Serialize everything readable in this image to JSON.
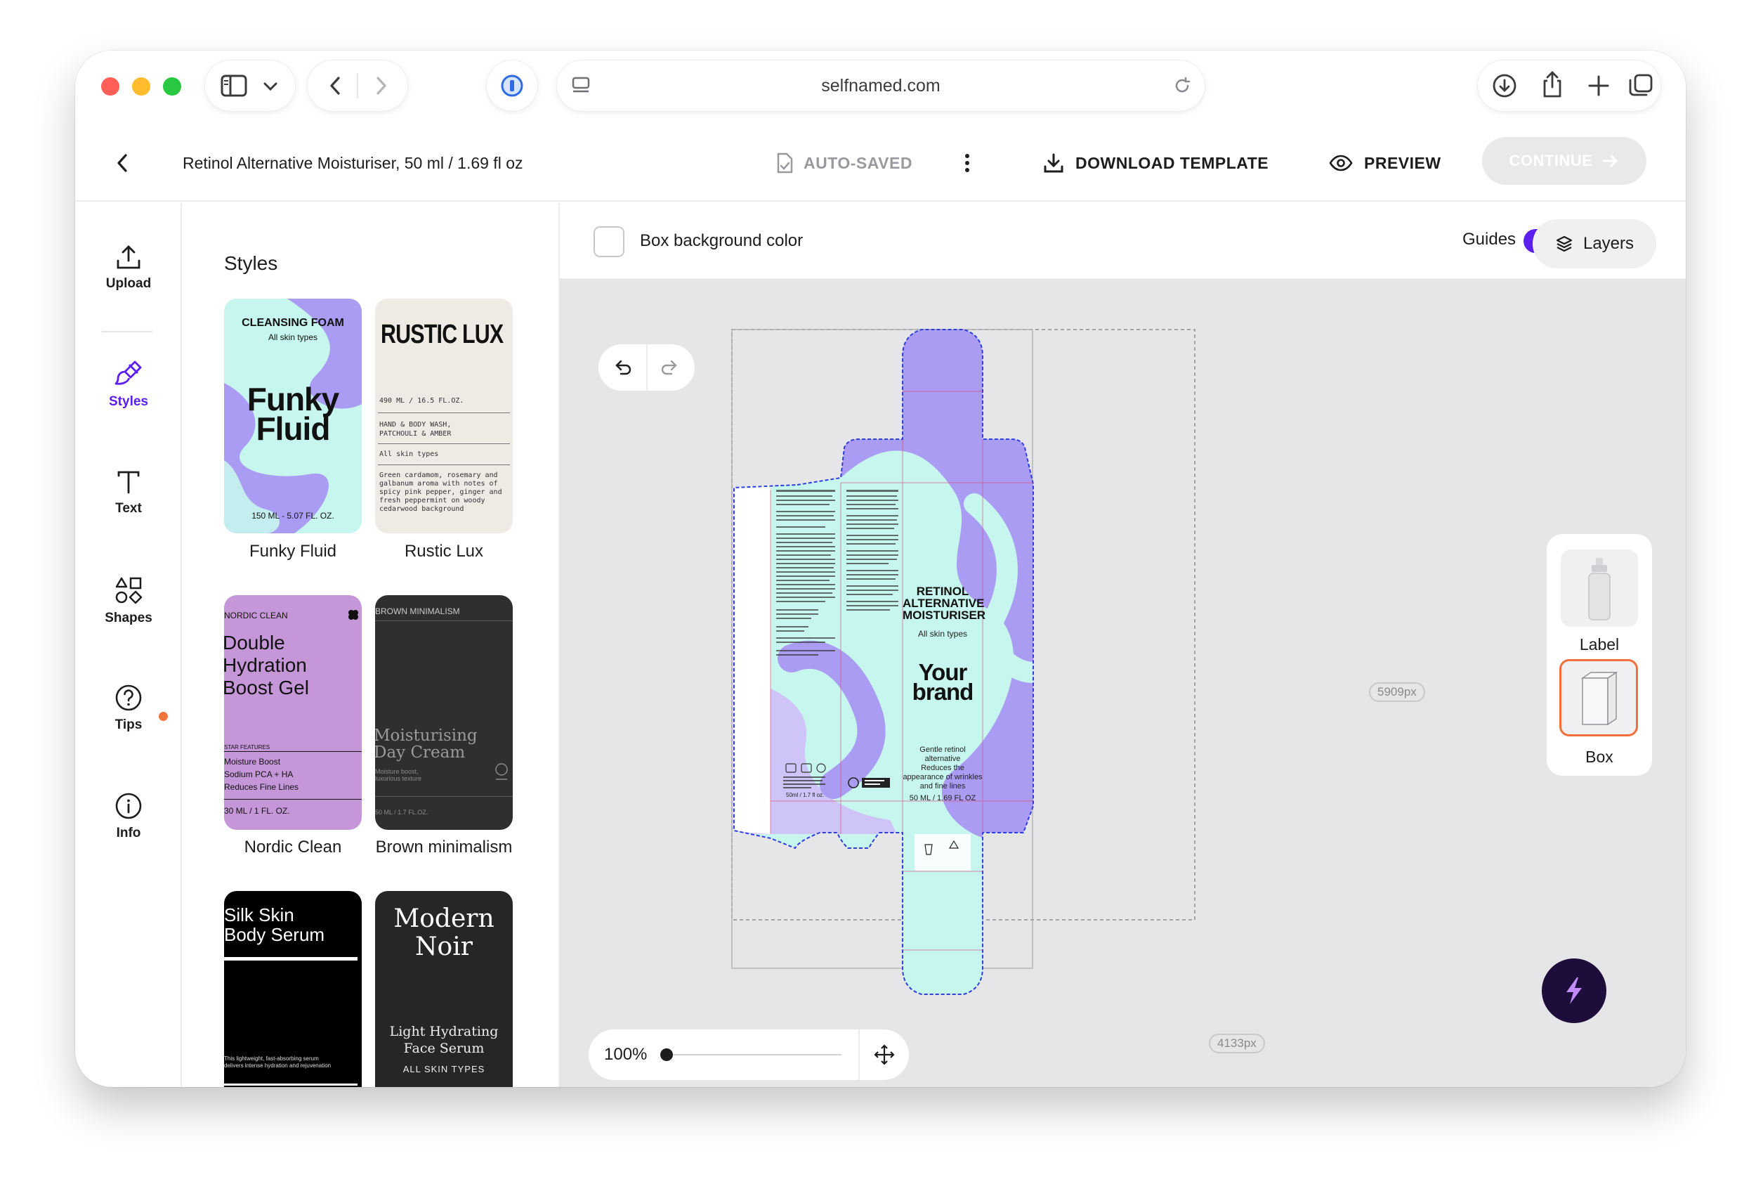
{
  "browser": {
    "url": "selfnamed.com"
  },
  "header": {
    "back_label": "",
    "product_title": "Retinol Alternative Moisturiser, 50 ml / 1.69 fl oz",
    "autosave_label": "AUTO-SAVED",
    "download_label": "DOWNLOAD TEMPLATE",
    "preview_label": "PREVIEW",
    "continue_label": "CONTINUE"
  },
  "rail": {
    "items": [
      {
        "label": "Upload",
        "icon": "upload-icon"
      },
      {
        "label": "Styles",
        "icon": "brush-icon",
        "active": true
      },
      {
        "label": "Text",
        "icon": "text-icon"
      },
      {
        "label": "Shapes",
        "icon": "shapes-icon"
      },
      {
        "label": "Tips",
        "icon": "question-icon"
      },
      {
        "label": "Info",
        "icon": "info-icon"
      }
    ]
  },
  "styles_panel": {
    "title": "Styles",
    "cards": [
      {
        "name": "Funky Fluid",
        "top": "CLEANSING FOAM",
        "sub": "All skin types",
        "big": "Funky\nFluid",
        "foot": "150 ML - 5.07 FL. OZ."
      },
      {
        "name": "Rustic Lux",
        "top": "RUSTIC LUX",
        "size": "490 ML / 16.5 FL.OZ.",
        "desc1": "HAND & BODY WASH,",
        "desc2": "PATCHOULI & AMBER",
        "type": "All skin types",
        "notes": "Green cardamom, rosemary and galbanum aroma with notes of spicy pink pepper, ginger and fresh peppermint on woody cedarwood background"
      },
      {
        "name": "Nordic Clean",
        "top": "NORDIC CLEAN",
        "title1": "Double",
        "title2": "Hydration",
        "title3": "Boost Gel",
        "feat_head": "STAR FEATURES",
        "feat1": "Moisture Boost",
        "feat2": "Sodium PCA + HA",
        "feat3": "Reduces Fine Lines",
        "foot": "30 ML / 1 FL. OZ."
      },
      {
        "name": "Brown minimalism",
        "top": "BROWN MINIMALISM",
        "title1": "Moisturising",
        "title2": "Day Cream",
        "sub1": "Moisture boost,",
        "sub2": "luxurious texture",
        "foot": "50 ML / 1.7 FL.OZ."
      },
      {
        "name": "Silk Skin",
        "title1": "Silk Skin",
        "title2": "Body Serum",
        "desc1": "This lightweight, fast-absorbing serum",
        "desc2": "delivers intense hydration and rejuvenation"
      },
      {
        "name": "Modern Noir",
        "title1": "Modern",
        "title2": "Noir",
        "sub1": "Light Hydrating",
        "sub2": "Face Serum",
        "type": "ALL SKIN TYPES"
      }
    ]
  },
  "toolbar": {
    "box_bg_label": "Box background color",
    "guides_label": "Guides",
    "guides_on": true,
    "layers_label": "Layers"
  },
  "canvas": {
    "width_label": "4133px",
    "height_label": "5909px",
    "zoom_label": "100%",
    "box": {
      "title1": "RETINOL",
      "title2": "ALTERNATIVE",
      "title3": "MOISTURISER",
      "skin": "All skin types",
      "brand1": "Your",
      "brand2": "brand",
      "claim1": "Gentle retinol",
      "claim2": "alternative",
      "claim3": "Reduces the",
      "claim4": "appearance of wrinkles",
      "claim5": "and fine lines",
      "size": "50 ML / 1.69 FL OZ",
      "mini_size": "50ml / 1.7 fl oz."
    }
  },
  "side_panel": {
    "items": [
      {
        "label": "Label",
        "selected": false
      },
      {
        "label": "Box",
        "selected": true
      }
    ]
  },
  "colors": {
    "accent": "#5b1ff0",
    "lavender": "#ab9cf3",
    "mint": "#c6f6ee",
    "selected_border": "#f26f3d"
  }
}
